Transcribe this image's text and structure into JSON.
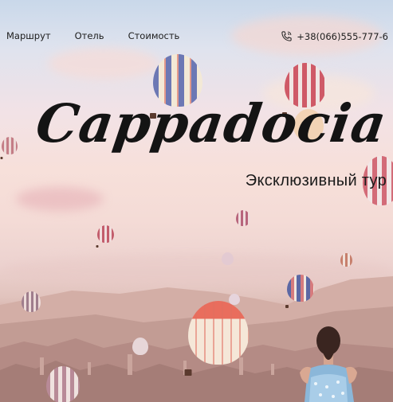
{
  "nav": {
    "items": [
      {
        "label": "Маршрут"
      },
      {
        "label": "Отель"
      },
      {
        "label": "Стоимость"
      }
    ]
  },
  "contact": {
    "icon": "phone-icon",
    "phone": "+38(066)555-777-6"
  },
  "hero": {
    "title": "Cappadocia",
    "subtitle": "Эксклюзивный тур"
  },
  "colors": {
    "text": "#1d1d1d",
    "sky_top": "#c9d8ea",
    "sky_mid": "#f4dbd6",
    "ground": "#a27d77"
  }
}
